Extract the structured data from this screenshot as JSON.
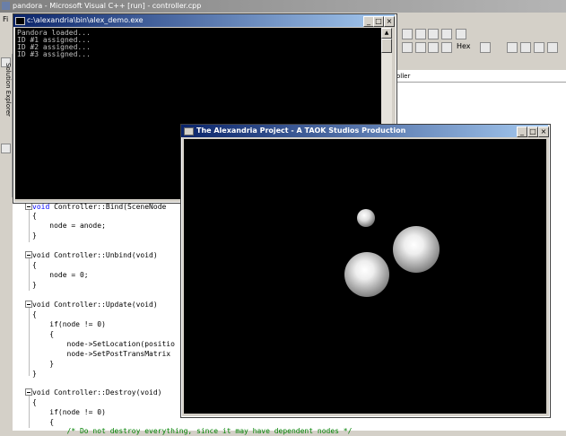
{
  "ide": {
    "title": "pandora - Microsoft Visual C++ [run] - controller.cpp",
    "menu_first": "Fi",
    "hex_label": "Hex",
    "solution_explorer": "Solution Explorer",
    "panel_header": "oller"
  },
  "console": {
    "title": "c:\\alexandria\\bin\\alex_demo.exe",
    "lines": [
      "Pandora loaded...",
      "ID #1 assigned...",
      "ID #2 assigned...",
      "ID #3 assigned..."
    ]
  },
  "alex_window": {
    "title": "The Alexandria Project - A TAOK Studios Production"
  },
  "code": {
    "lines": [
      "void Controller::Bind(SceneNode",
      "{",
      "    node = anode;",
      "}",
      "",
      "void Controller::Unbind(void)",
      "{",
      "    node = 0;",
      "}",
      "",
      "void Controller::Update(void)",
      "{",
      "    if(node != 0)",
      "    {",
      "        node->SetLocation(positio",
      "        node->SetPostTransMatrix",
      "    }",
      "}",
      "",
      "void Controller::Destroy(void)",
      "{",
      "    if(node != 0)",
      "    {",
      "        /* Do not destroy everything, since it may have dependent nodes */"
    ]
  }
}
